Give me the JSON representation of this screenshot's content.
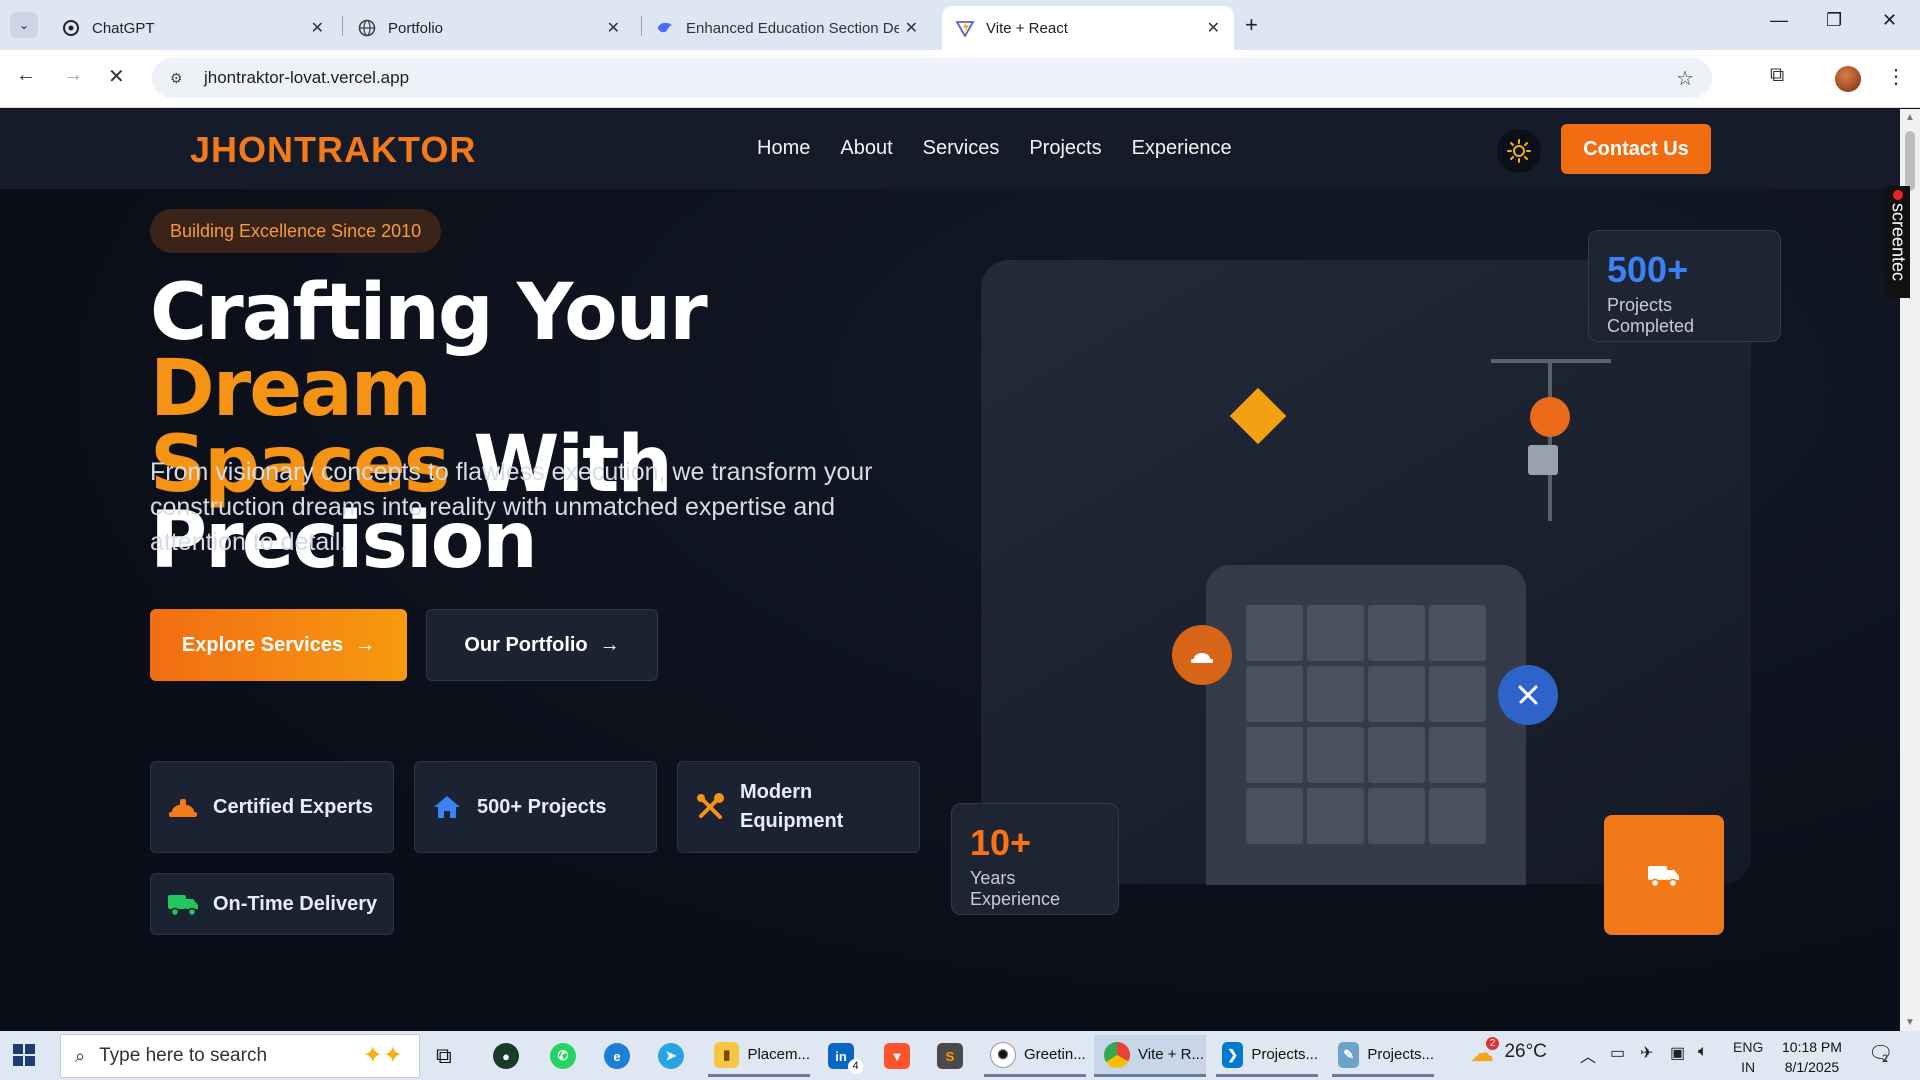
{
  "browser": {
    "tabs": [
      {
        "title": "ChatGPT",
        "icon": "chatgpt-icon"
      },
      {
        "title": "Portfolio",
        "icon": "globe-icon"
      },
      {
        "title": "Enhanced Education Section De",
        "icon": "deepseek-icon"
      },
      {
        "title": "Vite + React",
        "icon": "vite-icon"
      }
    ],
    "url": "jhontraktor-lovat.vercel.app"
  },
  "site": {
    "logo": "JHONTRAKTOR",
    "nav": [
      "Home",
      "About",
      "Services",
      "Projects",
      "Experience"
    ],
    "contact_label": "Contact Us",
    "badge": "Building Excellence Since 2010",
    "headline": {
      "part1": "Crafting Your ",
      "highlight1": "Dream",
      "highlight2": "Spaces",
      "part2": " With Precision"
    },
    "lead": "From visionary concepts to flawless execution, we transform your construction dreams into reality with unmatched expertise and attention to detail.",
    "primary_btn": "Explore Services",
    "secondary_btn": "Our Portfolio",
    "features": [
      {
        "label": "Certified Experts",
        "icon": "helmet-icon"
      },
      {
        "label": "500+ Projects",
        "icon": "house-icon"
      },
      {
        "label": "Modern Equipment",
        "icon": "tools-icon"
      },
      {
        "label": "On-Time Delivery",
        "icon": "truck-icon"
      }
    ],
    "stats": [
      {
        "value": "500+",
        "label": "Projects Completed",
        "color": "#3b82f6"
      },
      {
        "value": "10+",
        "label": "Years Experience",
        "color": "#f97316"
      }
    ],
    "accent": "#f26d12"
  },
  "overlay": {
    "screentec": "screentec"
  },
  "taskbar": {
    "search_placeholder": "Type here to search",
    "apps": [
      "Placem...",
      "Greetin...",
      "Vite + R...",
      "Projects...",
      "Projects..."
    ],
    "linkedin_badge": "4",
    "weather": "26°C",
    "weather_badge": "2",
    "lang1": "ENG",
    "lang2": "IN",
    "time": "10:18 PM",
    "date": "8/1/2025",
    "notif_count": "2"
  }
}
